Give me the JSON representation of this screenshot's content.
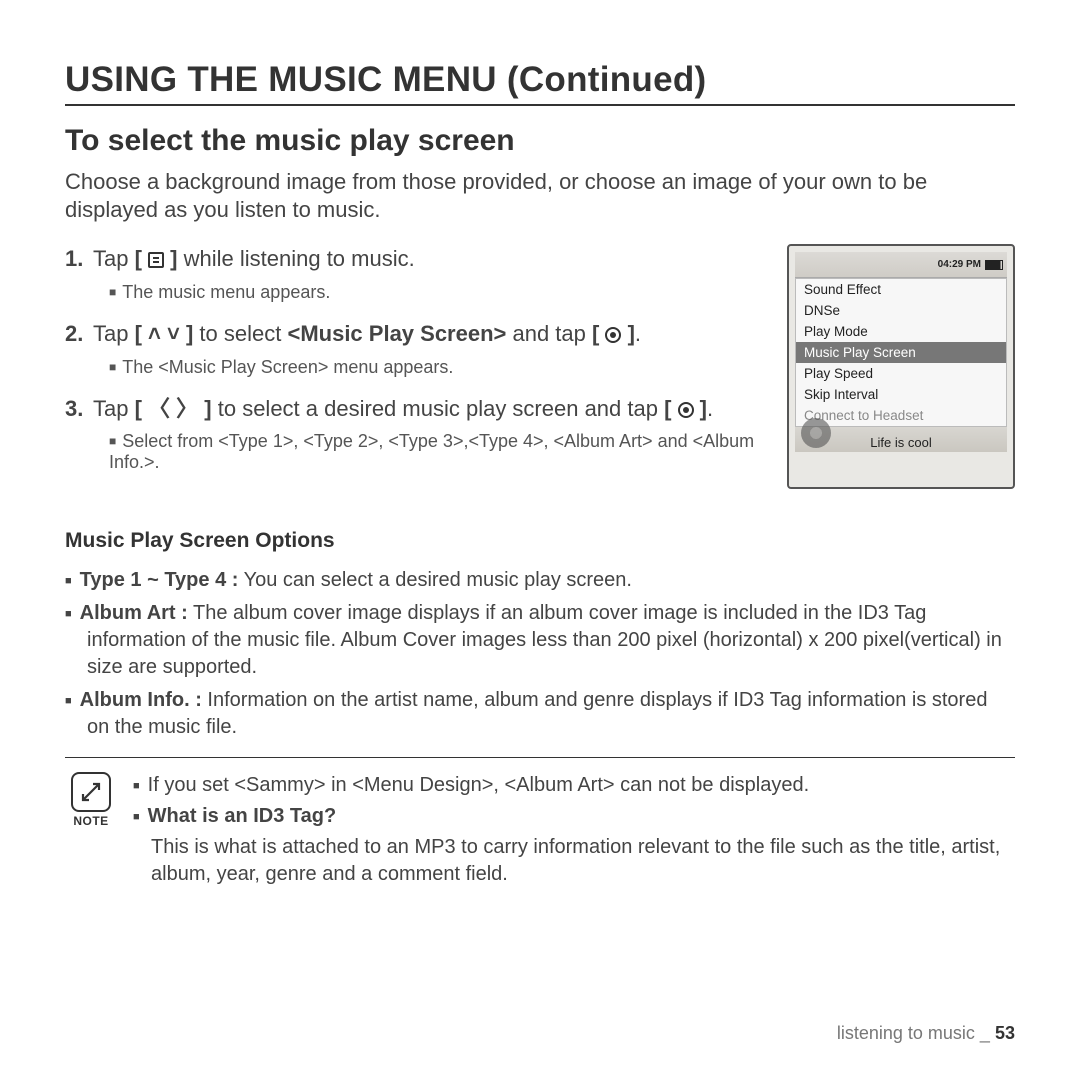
{
  "title": "USING THE MUSIC MENU (Continued)",
  "section": "To select the music play screen",
  "intro": "Choose a background image from those provided, or choose an image of your own to be displayed as you listen to music.",
  "steps": [
    {
      "num": "1.",
      "pre": "Tap ",
      "icon": "menu",
      "post": " while listening to music.",
      "sub": "The music menu appears."
    },
    {
      "num": "2.",
      "pre": "Tap ",
      "icon": "updown",
      "mid": " to select ",
      "boldmid": "<Music Play Screen>",
      "post2": " and tap ",
      "icon2": "circle",
      "post3": ".",
      "sub": "The <Music Play Screen> menu appears."
    },
    {
      "num": "3.",
      "pre": "Tap ",
      "icon": "leftright",
      "post": " to select a desired music play screen and tap ",
      "icon2": "circle",
      "post3": ".",
      "sub": "Select from <Type 1>, <Type 2>, <Type 3>,<Type 4>, <Album Art> and <Album Info.>."
    }
  ],
  "device": {
    "time": "04:29 PM",
    "items": [
      "Sound Effect",
      "DNSe",
      "Play Mode",
      "Music Play Screen",
      "Play Speed",
      "Skip Interval",
      "Connect to Headset"
    ],
    "selectedIndex": 3,
    "dimIndex": 6,
    "footer": "Life is cool"
  },
  "optionsTitle": "Music Play Screen Options",
  "options": [
    {
      "label": "Type 1 ~ Type 4 :",
      "text": "You can select a desired music play screen."
    },
    {
      "label": "Album Art :",
      "text": "The album cover image displays if an album cover image is included in the ID3 Tag information of the music file. Album Cover images less than 200 pixel (horizontal) x 200 pixel(vertical) in size are supported."
    },
    {
      "label": "Album Info. :",
      "text": "Information on the artist name, album and genre displays if ID3 Tag information is stored on the music file."
    }
  ],
  "note": {
    "badge": "NOTE",
    "line1": "If you set <Sammy> in <Menu Design>, <Album Art> can not be displayed.",
    "question": "What is an ID3 Tag?",
    "answer": "This is what is attached to an MP3 to carry information relevant to the file such as the title, artist, album, year, genre and a comment field."
  },
  "footer": {
    "section": "listening to music _",
    "page": "53"
  }
}
